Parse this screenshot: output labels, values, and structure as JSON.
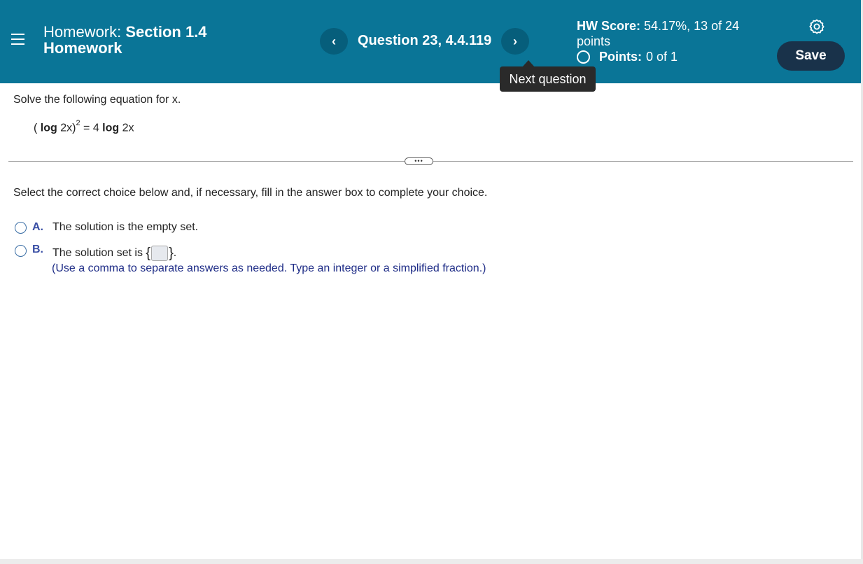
{
  "header": {
    "homework_label": "Homework:",
    "homework_title_line1": "Section 1.4",
    "homework_title_line2": "Homework",
    "question_label": "Question 23, 4.4.119",
    "prev_label": "‹",
    "next_label": "›",
    "tooltip": "Next question",
    "hw_score_label": "HW Score:",
    "hw_score_value": "54.17%, 13 of 24",
    "hw_score_unit": "points",
    "points_label": "Points:",
    "points_value": "0 of 1",
    "save_label": "Save",
    "colors": {
      "bar": "#0a7597",
      "nav_button": "#065e7b",
      "save_button": "#19324a"
    }
  },
  "question": {
    "prompt": "Solve the following equation for x.",
    "eq_open": "(",
    "eq_log1": "log",
    "eq_arg1": " 2x)",
    "eq_exp": "2",
    "eq_mid": " = 4 ",
    "eq_log2": "log",
    "eq_arg2": " 2x",
    "divider_handle": "•••",
    "instruction": "Select the correct choice below and, if necessary, fill in the answer box to complete your choice."
  },
  "choices": [
    {
      "letter": "A.",
      "text": "The solution is the empty set."
    },
    {
      "letter": "B.",
      "text_before": "The solution set is",
      "brace_open": "{",
      "brace_close": "}",
      "text_after": "."
    }
  ],
  "hint": "(Use a comma to separate answers as needed. Type an integer or a simplified fraction.)"
}
